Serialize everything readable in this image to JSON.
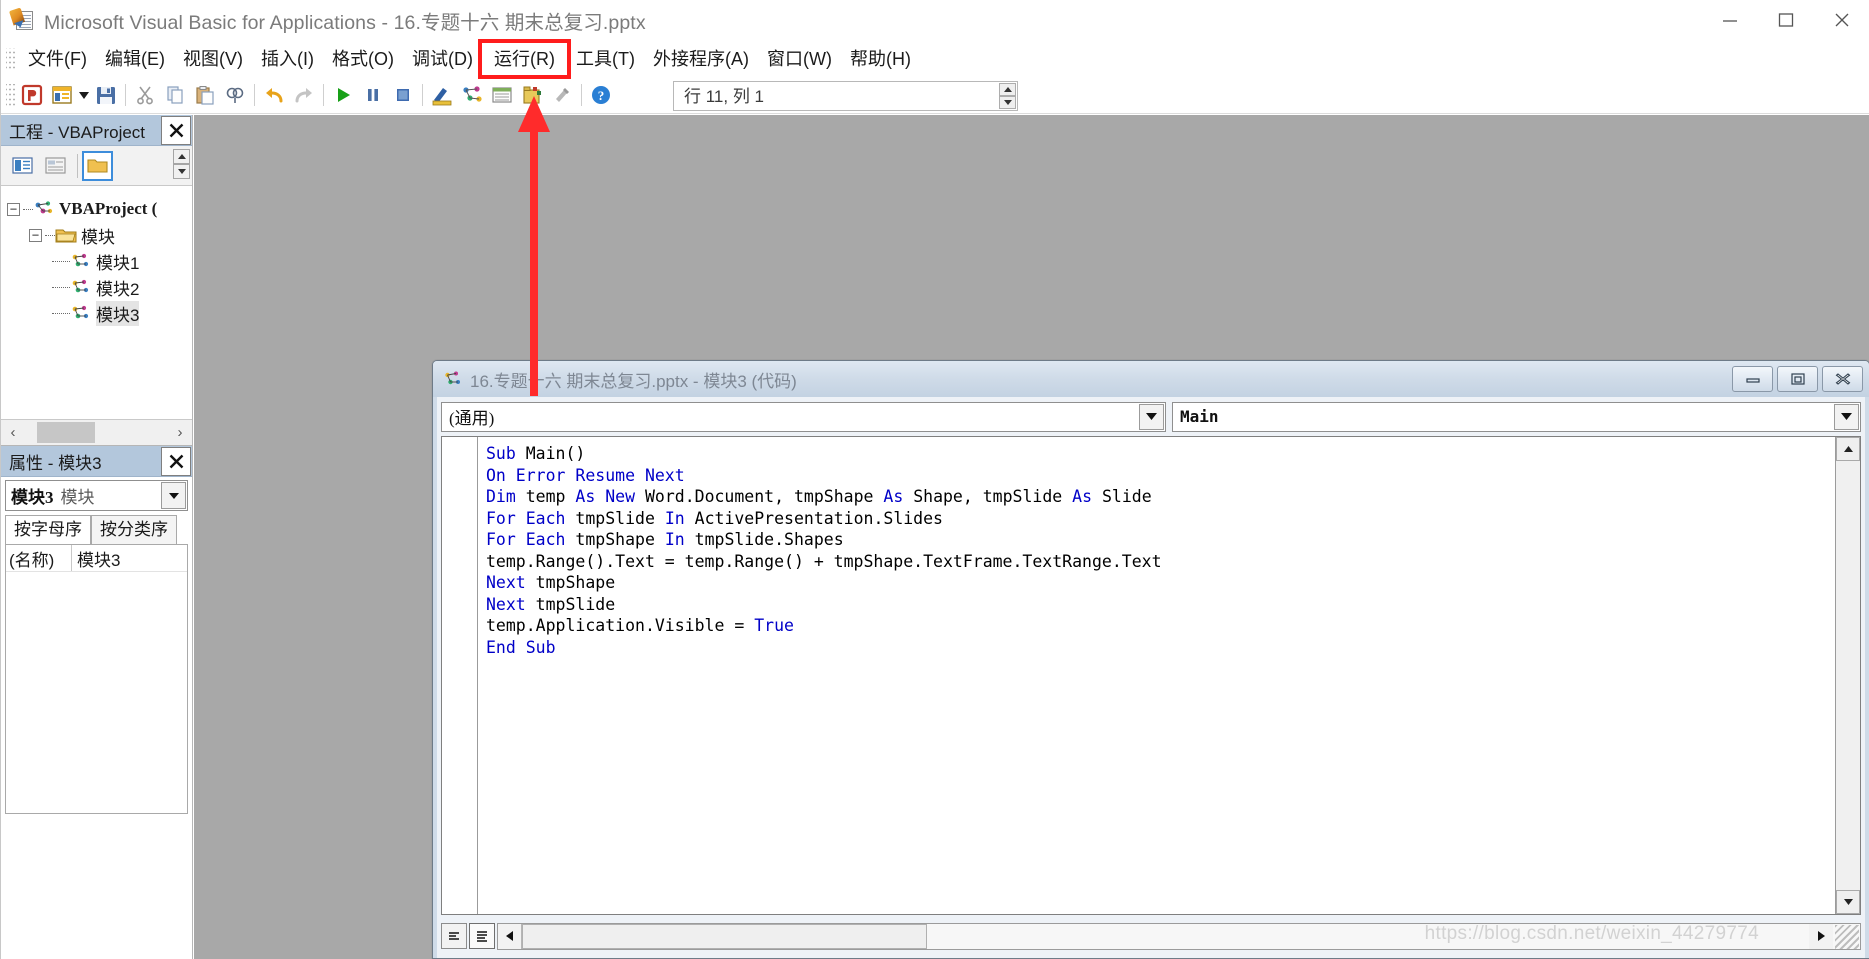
{
  "window": {
    "title": "Microsoft Visual Basic for Applications - 16.专题十六 期末总复习.pptx",
    "icon": "vba-app-icon",
    "controls": {
      "minimize": "minimize-icon",
      "maximize": "maximize-icon",
      "close": "close-icon"
    }
  },
  "menubar": {
    "items": [
      {
        "label": "文件(F)",
        "accel": "F",
        "highlighted": false
      },
      {
        "label": "编辑(E)",
        "accel": "E",
        "highlighted": false
      },
      {
        "label": "视图(V)",
        "accel": "V",
        "highlighted": false
      },
      {
        "label": "插入(I)",
        "accel": "I",
        "highlighted": false
      },
      {
        "label": "格式(O)",
        "accel": "O",
        "highlighted": false
      },
      {
        "label": "调试(D)",
        "accel": "D",
        "highlighted": false
      },
      {
        "label": "运行(R)",
        "accel": "R",
        "highlighted": true
      },
      {
        "label": "工具(T)",
        "accel": "T",
        "highlighted": false
      },
      {
        "label": "外接程序(A)",
        "accel": "A",
        "highlighted": false
      },
      {
        "label": "窗口(W)",
        "accel": "W",
        "highlighted": false
      },
      {
        "label": "帮助(H)",
        "accel": "H",
        "highlighted": false
      }
    ],
    "highlight_color": "#ff1c1c"
  },
  "toolbar": {
    "buttons": [
      "view-powerpoint-icon",
      "insert-userform-icon",
      "dropdown-caret-icon",
      "save-icon",
      "cut-icon",
      "copy-icon",
      "paste-icon",
      "find-icon",
      "undo-icon",
      "redo-icon",
      "run-icon",
      "break-icon",
      "reset-icon",
      "design-mode-icon",
      "project-explorer-icon",
      "properties-window-icon",
      "object-browser-icon",
      "toolbox-icon",
      "help-icon"
    ],
    "position_text": "行 11, 列 1"
  },
  "project_panel": {
    "caption": "工程 - VBAProject",
    "close_label": "✕",
    "toolbar_buttons": [
      "view-code-icon",
      "view-object-icon",
      "toggle-folders-icon"
    ],
    "tree": [
      {
        "label": "VBAProject (",
        "level": 0,
        "expander": "−",
        "icon": "vbaproject-icon",
        "bold": true,
        "selected": false
      },
      {
        "label": "模块",
        "level": 1,
        "expander": "−",
        "icon": "folder-icon",
        "bold": false,
        "selected": false
      },
      {
        "label": "模块1",
        "level": 2,
        "expander": "",
        "icon": "module-icon",
        "bold": false,
        "selected": false
      },
      {
        "label": "模块2",
        "level": 2,
        "expander": "",
        "icon": "module-icon",
        "bold": false,
        "selected": false
      },
      {
        "label": "模块3",
        "level": 2,
        "expander": "",
        "icon": "module-icon",
        "bold": false,
        "selected": true
      }
    ]
  },
  "properties_panel": {
    "caption": "属性 - 模块3",
    "close_label": "✕",
    "object_name": "模块3",
    "object_type": "模块",
    "tabs": [
      {
        "label": "按字母序",
        "active": true
      },
      {
        "label": "按分类序",
        "active": false
      }
    ],
    "rows": [
      {
        "key": "(名称)",
        "value": "模块3"
      }
    ]
  },
  "code_window": {
    "title": "16.专题十六 期末总复习.pptx - 模块3 (代码)",
    "icon": "module-icon",
    "controls": {
      "minimize": "minimize-icon",
      "restore": "restore-icon",
      "close": "close-icon"
    },
    "object_combo": "(通用)",
    "procedure_combo": "Main",
    "code_lines": [
      [
        {
          "t": "Sub",
          "k": true
        },
        {
          "t": " Main()",
          "k": false
        }
      ],
      [
        {
          "t": "On Error Resume Next",
          "k": true
        }
      ],
      [
        {
          "t": "Dim",
          "k": true
        },
        {
          "t": " temp ",
          "k": false
        },
        {
          "t": "As New",
          "k": true
        },
        {
          "t": " Word.Document, tmpShape ",
          "k": false
        },
        {
          "t": "As",
          "k": true
        },
        {
          "t": " Shape, tmpSlide ",
          "k": false
        },
        {
          "t": "As",
          "k": true
        },
        {
          "t": " Slide",
          "k": false
        }
      ],
      [
        {
          "t": "For Each",
          "k": true
        },
        {
          "t": " tmpSlide ",
          "k": false
        },
        {
          "t": "In",
          "k": true
        },
        {
          "t": " ActivePresentation.Slides",
          "k": false
        }
      ],
      [
        {
          "t": "For Each",
          "k": true
        },
        {
          "t": " tmpShape ",
          "k": false
        },
        {
          "t": "In",
          "k": true
        },
        {
          "t": " tmpSlide.Shapes",
          "k": false
        }
      ],
      [
        {
          "t": "temp.Range().Text = temp.Range() + tmpShape.TextFrame.TextRange.Text",
          "k": false
        }
      ],
      [
        {
          "t": "Next",
          "k": true
        },
        {
          "t": " tmpShape",
          "k": false
        }
      ],
      [
        {
          "t": "Next",
          "k": true
        },
        {
          "t": " tmpSlide",
          "k": false
        }
      ],
      [
        {
          "t": "temp.Application.Visible = ",
          "k": false
        },
        {
          "t": "True",
          "k": true
        }
      ],
      [
        {
          "t": "End Sub",
          "k": true
        }
      ]
    ],
    "bottom_buttons": [
      "procedure-view-icon",
      "full-module-view-icon"
    ]
  },
  "annotation": {
    "type": "red-arrow",
    "color": "#ff2b2b",
    "points_to": "运行(R)"
  },
  "watermark": "https://blog.csdn.net/weixin_44279774"
}
